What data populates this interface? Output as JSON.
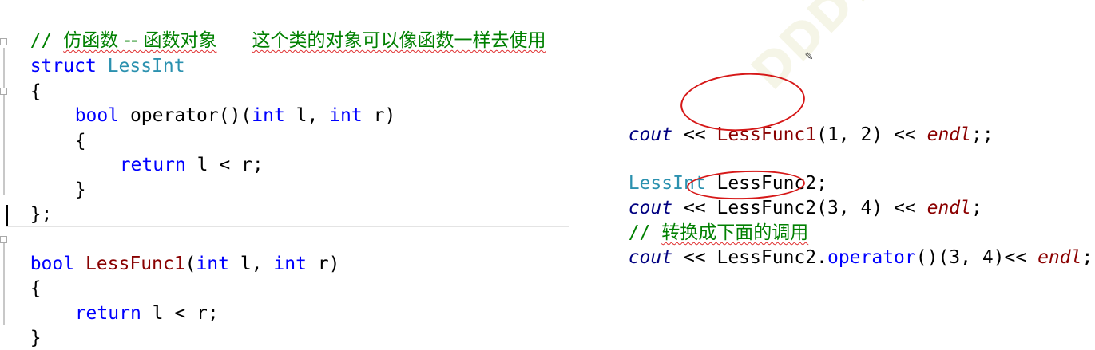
{
  "comment_header": {
    "prefix": "// ",
    "title": "仿函数 -- 函数对象",
    "desc": "这个类的对象可以像函数一样去使用"
  },
  "left_code": {
    "struct_kw": "struct",
    "struct_name": "LessInt",
    "open_brace": "{",
    "op_bool": "bool",
    "op_name": " operator()(",
    "op_int1": "int",
    "op_l": " l, ",
    "op_int2": "int",
    "op_r": " r)",
    "inner_open": "{",
    "ret_kw": "return",
    "ret_expr": " l < r;",
    "inner_close": "}",
    "struct_close": "};",
    "fn_bool": "bool",
    "fn_name": "LessFunc1",
    "fn_paren": "(",
    "fn_int1": "int",
    "fn_l": " l, ",
    "fn_int2": "int",
    "fn_r": " r)",
    "fn_open": "{",
    "fn_ret_kw": "return",
    "fn_ret_expr": " l < r;",
    "fn_close": "}"
  },
  "right_code": {
    "l1_cout": "cout",
    "l1_op": " << ",
    "l1_fn": "LessFunc1",
    "l1_args": "(1, 2) << ",
    "l1_endl": "endl",
    "l1_end": ";;",
    "l2_type": "LessInt",
    "l2_var": " LessFunc2;",
    "l3_cout": "cout",
    "l3_op": " << ",
    "l3_fn": "LessFunc2",
    "l3_args": "(3, 4) << ",
    "l3_endl": "endl",
    "l3_end": ";",
    "l4_prefix": "// ",
    "l4_text": "转换成下面的调用",
    "l5_cout": "cout",
    "l5_op": " << ",
    "l5_obj": "LessFunc2.",
    "l5_method": "operator",
    "l5_args": "()(3, 4)<< ",
    "l5_endl": "endl",
    "l5_end": ";"
  },
  "watermark": "DDDY"
}
